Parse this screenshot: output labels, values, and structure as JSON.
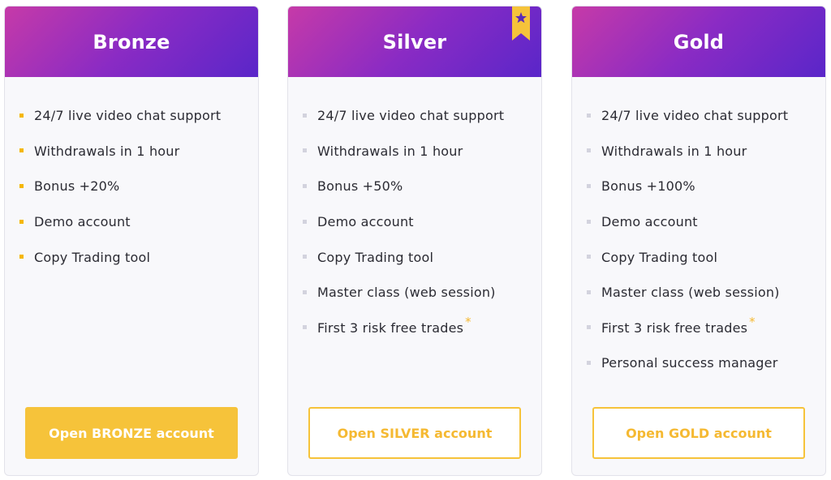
{
  "colors": {
    "accent": "#f6c33a",
    "header_gradient": [
      "#c63aa8",
      "#8a2bc4",
      "#5a26c9"
    ],
    "bronze_bullet": "#f5b700",
    "other_bullet": "#d3d3de",
    "text": "#2b2b33"
  },
  "plans": [
    {
      "title": "Bronze",
      "features": [
        "24/7 live video chat support",
        "Withdrawals in 1 hour",
        "Bonus +20%",
        "Demo account",
        "Copy Trading tool"
      ],
      "button": "Open BRONZE account"
    },
    {
      "title": "Silver",
      "badge_icon": "star-ribbon-icon",
      "features": [
        "24/7 live video chat support",
        "Withdrawals in 1 hour",
        "Bonus +50%",
        "Demo account",
        "Copy Trading tool",
        "Master class (web session)",
        "First 3 risk free trades"
      ],
      "footnote_mark": "*",
      "button": "Open SILVER account"
    },
    {
      "title": "Gold",
      "features": [
        "24/7 live video chat support",
        "Withdrawals in 1 hour",
        "Bonus +100%",
        "Demo account",
        "Copy Trading tool",
        "Master class (web session)",
        "First 3 risk free trades",
        "Personal success manager"
      ],
      "footnote_mark": "*",
      "button": "Open GOLD account"
    }
  ]
}
